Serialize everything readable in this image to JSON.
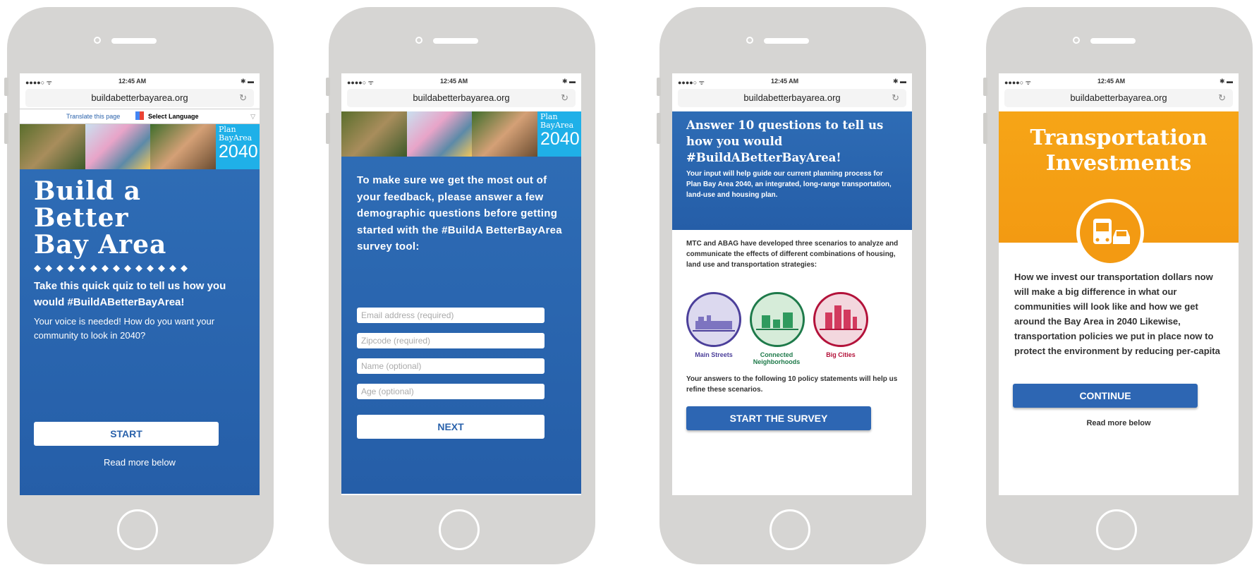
{
  "browser": {
    "url": "buildabetterbayarea.org",
    "time": "12:45 AM",
    "signal": "●●●●○ ᯤ",
    "battery": "✱ ▬"
  },
  "screen1": {
    "translate_link": "Translate this page",
    "select_language": "Select Language",
    "logo_top": "Plan",
    "logo_mid": "BayArea",
    "logo_year": "2040",
    "title_line1": "Build a",
    "title_line2": "Better",
    "title_line3": "Bay Area",
    "lead": "Take this quick quiz to tell us how you would #BuildABetterBayArea!",
    "body": "Your voice is needed! How do you want your community to look in 2040?",
    "start_label": "START",
    "read_more": "Read more below"
  },
  "screen2": {
    "intro": "To make sure we get the most out of your feedback, please answer a few demographic questions before getting started with the #BuildA BetterBayArea survey tool:",
    "email_placeholder": "Email address (required)",
    "zip_placeholder": "Zipcode (required)",
    "name_placeholder": "Name (optional)",
    "age_placeholder": "Age (optional)",
    "next_label": "NEXT"
  },
  "screen3": {
    "heading": "Answer 10 questions to tell us how you would #BuildABetterBayArea!",
    "subtext": "Your input will help guide our current planning process for Plan Bay Area 2040, an integrated, long-range transportation, land-use and housing plan.",
    "description": "MTC and ABAG have developed three scenarios to analyze and communicate the effects of different combinations of housing, land use and transportation strategies:",
    "scenarios": [
      {
        "label": "Main Streets",
        "color": "#4b3f9a"
      },
      {
        "label": "Connected Neighborhoods",
        "color": "#1e7a4a"
      },
      {
        "label": "Big Cities",
        "color": "#b3123a"
      }
    ],
    "footer": "Your answers to the following 10 policy statements will help us refine these scenarios.",
    "survey_label": "START THE SURVEY"
  },
  "screen4": {
    "title": "Transportation Investments",
    "body": "How we invest our transportation dollars now will make a big difference in what our communities will look like and how we get around the Bay Area in 2040 Likewise, transportation policies we put in place now to protect the environment by reducing per-capita",
    "continue_label": "CONTINUE",
    "read_more": "Read more below"
  }
}
